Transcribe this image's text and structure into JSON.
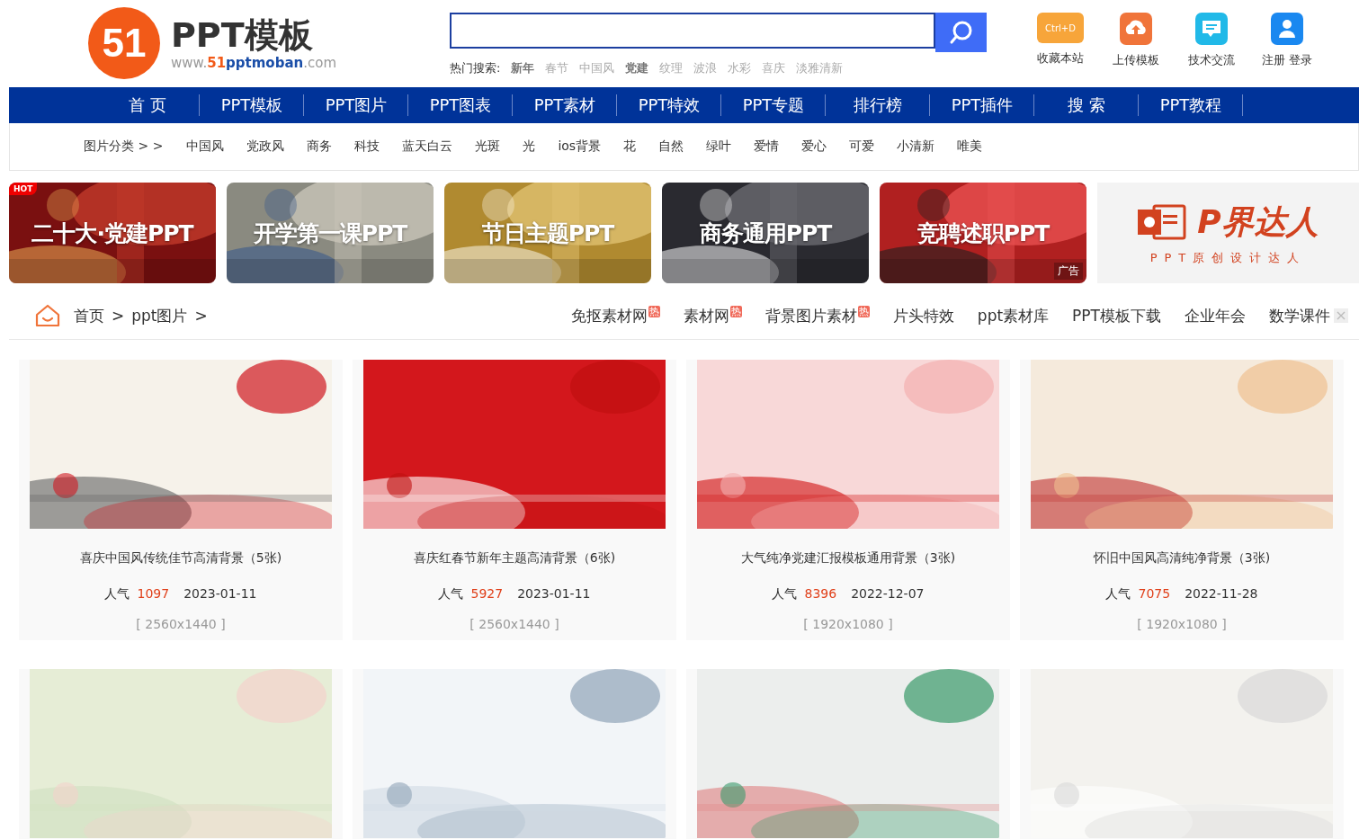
{
  "logo": {
    "mark": "51",
    "title": "PPT模板",
    "url_prefix": "www.",
    "url_num": "51",
    "url_name": "pptmoban",
    "url_suffix": ".com"
  },
  "search": {
    "hot_label": "热门搜索:",
    "hot_terms": [
      {
        "label": "新年",
        "hot": true
      },
      {
        "label": "春节",
        "hot": false
      },
      {
        "label": "中国风",
        "hot": false
      },
      {
        "label": "党建",
        "hot": true
      },
      {
        "label": "纹理",
        "hot": false
      },
      {
        "label": "波浪",
        "hot": false
      },
      {
        "label": "水彩",
        "hot": false
      },
      {
        "label": "喜庆",
        "hot": false
      },
      {
        "label": "淡雅清新",
        "hot": false
      }
    ]
  },
  "shortcuts": [
    {
      "label": "收藏本站",
      "kind": "bookmark",
      "key": "Ctrl+D"
    },
    {
      "label": "上传模板",
      "kind": "upload"
    },
    {
      "label": "技术交流",
      "kind": "chat"
    },
    {
      "label": "注册 登录",
      "kind": "user"
    }
  ],
  "nav": [
    {
      "label": "首 页",
      "selected": false
    },
    {
      "label": "PPT模板",
      "selected": false
    },
    {
      "label": "PPT图片",
      "selected": false
    },
    {
      "label": "PPT图表",
      "selected": false
    },
    {
      "label": "PPT素材",
      "selected": false
    },
    {
      "label": "PPT特效",
      "selected": false
    },
    {
      "label": "PPT专题",
      "selected": false
    },
    {
      "label": "排行榜",
      "selected": false
    },
    {
      "label": "PPT插件",
      "selected": false
    },
    {
      "label": "搜 索",
      "selected": false
    },
    {
      "label": "PPT教程",
      "selected": false
    }
  ],
  "categories": {
    "label": "图片分类 > >",
    "items": [
      "中国风",
      "党政风",
      "商务",
      "科技",
      "蓝天白云",
      "光斑",
      "光",
      "ios背景",
      "花",
      "自然",
      "绿叶",
      "爱情",
      "爱心",
      "可爱",
      "小清新",
      "唯美"
    ]
  },
  "banners": [
    {
      "title": "二十大·党建PPT",
      "hot_tag": "HOT"
    },
    {
      "title": "开学第一课PPT"
    },
    {
      "title": "节日主题PPT"
    },
    {
      "title": "商务通用PPT"
    },
    {
      "title": "竞聘述职PPT",
      "ad": "广告"
    }
  ],
  "brand_banner": {
    "name": "P界达人",
    "tagline": "PPT原创设计达人"
  },
  "breadcrumb": [
    {
      "label": "首页",
      "separator": ">"
    },
    {
      "label": "ppt图片",
      "separator": ">"
    }
  ],
  "quick_links": [
    {
      "label": "免抠素材网",
      "badge": "热"
    },
    {
      "label": "素材网",
      "badge": "热"
    },
    {
      "label": "背景图片素材",
      "badge": "热"
    },
    {
      "label": "片头特效"
    },
    {
      "label": "ppt素材库"
    },
    {
      "label": "PPT模板下载"
    },
    {
      "label": "企业年会"
    },
    {
      "label": "数学课件"
    }
  ],
  "cards": [
    {
      "title": "喜庆中国风传统佳节高清背景（5张)",
      "pop_label": "人气",
      "popularity": "1097",
      "date": "2023-01-11",
      "size": "[ 2560x1440 ]"
    },
    {
      "title": "喜庆红春节新年主题高清背景（6张)",
      "pop_label": "人气",
      "popularity": "5927",
      "date": "2023-01-11",
      "size": "[ 2560x1440 ]"
    },
    {
      "title": "大气纯净党建汇报模板通用背景（3张)",
      "pop_label": "人气",
      "popularity": "8396",
      "date": "2022-12-07",
      "size": "[ 1920x1080 ]"
    },
    {
      "title": "怀旧中国风高清纯净背景（3张)",
      "pop_label": "人气",
      "popularity": "7075",
      "date": "2022-11-28",
      "size": "[ 1920x1080 ]"
    },
    {
      "kind": "picture"
    },
    {
      "kind": "picture"
    },
    {
      "kind": "picture"
    },
    {
      "kind": "picture"
    }
  ]
}
